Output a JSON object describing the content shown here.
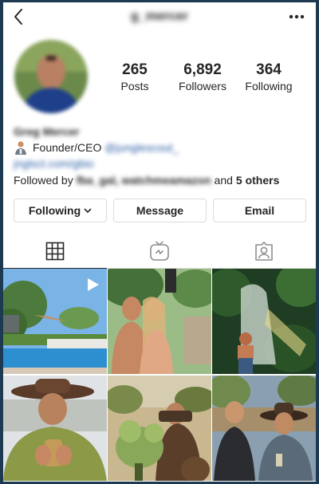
{
  "header": {
    "username": "g_mercer",
    "back_icon": "chevron-left-icon",
    "more_icon": "more-dots-icon"
  },
  "stats": {
    "posts": {
      "value": "265",
      "label": "Posts"
    },
    "followers": {
      "value": "6,892",
      "label": "Followers"
    },
    "following": {
      "value": "364",
      "label": "Following"
    }
  },
  "bio": {
    "name": "Greg Mercer",
    "role": "Founder/CEO",
    "mention": "@junglescout_",
    "link": "jnglsct.com/gbio",
    "followed_by_prefix": "Followed by",
    "followed_by_names": "fba_gal, watchmeamazon",
    "followed_by_and": "and",
    "followed_by_others": "5 others"
  },
  "buttons": {
    "following": "Following",
    "message": "Message",
    "email": "Email"
  },
  "tabs": [
    {
      "name": "grid",
      "icon": "grid-icon"
    },
    {
      "name": "igtv",
      "icon": "igtv-icon"
    },
    {
      "name": "tagged",
      "icon": "tagged-user-icon"
    }
  ],
  "colors": {
    "link": "#2a5ea8",
    "border": "#dbdbdb",
    "text": "#262626",
    "frame": "#1d3a52"
  }
}
